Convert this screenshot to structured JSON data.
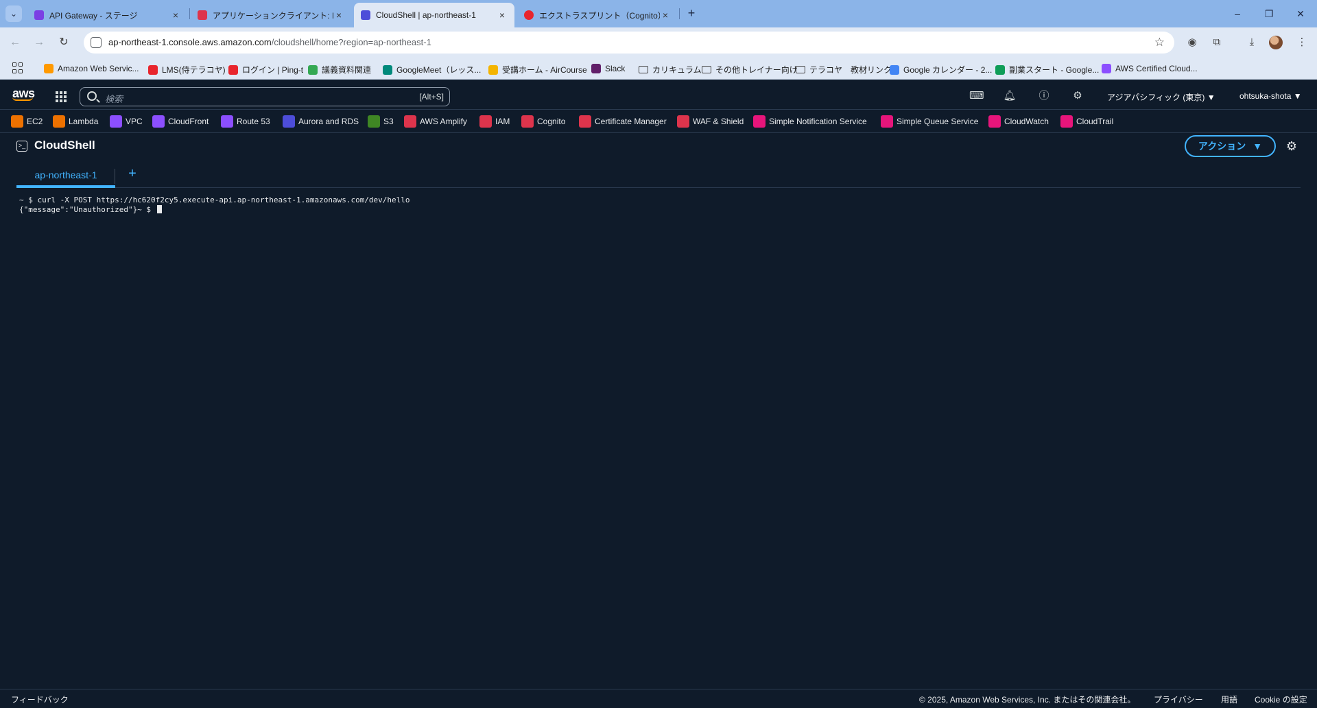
{
  "browser": {
    "tabs": [
      {
        "title": "API Gateway - ステージ",
        "color": "#7b3fe4"
      },
      {
        "title": "アプリケーションクライアント: My SPA",
        "color": "#dd344c"
      },
      {
        "title": "CloudShell | ap-northeast-1",
        "color": "#4d4dd9"
      },
      {
        "title": "エクストラスプリント（Cognito）| ファ",
        "color": "#e8252d"
      }
    ],
    "new_tab": "+",
    "close_glyph": "×",
    "url_host": "ap-northeast-1.console.aws.amazon.com",
    "url_path": "/cloudshell/home?region=ap-northeast-1",
    "bookmarks": [
      {
        "label": "Amazon Web Servic...",
        "color": "#ff9900"
      },
      {
        "label": "LMS(侍テラコヤ)",
        "color": "#e8252d"
      },
      {
        "label": "ログイン | Ping-t",
        "color": "#e8252d"
      },
      {
        "label": "議義資料関連",
        "color": "#34a853"
      },
      {
        "label": "GoogleMeet（レッス...",
        "color": "#00897b"
      },
      {
        "label": "受講ホーム - AirCourse",
        "color": "#f4b400"
      },
      {
        "label": "Slack",
        "color": "#611f69"
      },
      {
        "label": "カリキュラム",
        "folder": true
      },
      {
        "label": "その他トレイナー向け",
        "folder": true
      },
      {
        "label": "テラコヤ　教材リンク",
        "folder": true
      },
      {
        "label": "Google カレンダー - 2...",
        "color": "#4285f4"
      },
      {
        "label": "副業スタート - Google...",
        "color": "#0f9d58"
      },
      {
        "label": "AWS Certified Cloud...",
        "color": "#8c4fff"
      }
    ]
  },
  "aws_header": {
    "logo": "aws",
    "search_placeholder": "検索",
    "search_shortcut": "[Alt+S]",
    "region": "アジアパシフィック (東京) ▼",
    "user": "ohtsuka-shota ▼"
  },
  "favorites": [
    {
      "label": "EC2",
      "color": "#ed7100"
    },
    {
      "label": "Lambda",
      "color": "#ed7100"
    },
    {
      "label": "VPC",
      "color": "#8c4fff"
    },
    {
      "label": "CloudFront",
      "color": "#8c4fff"
    },
    {
      "label": "Route 53",
      "color": "#8c4fff"
    },
    {
      "label": "Aurora and RDS",
      "color": "#4d4dd9"
    },
    {
      "label": "S3",
      "color": "#3f8624"
    },
    {
      "label": "AWS Amplify",
      "color": "#dd344c"
    },
    {
      "label": "IAM",
      "color": "#dd344c"
    },
    {
      "label": "Cognito",
      "color": "#dd344c"
    },
    {
      "label": "Certificate Manager",
      "color": "#dd344c"
    },
    {
      "label": "WAF & Shield",
      "color": "#dd344c"
    },
    {
      "label": "Simple Notification Service",
      "color": "#e7157b"
    },
    {
      "label": "Simple Queue Service",
      "color": "#e7157b"
    },
    {
      "label": "CloudWatch",
      "color": "#e7157b"
    },
    {
      "label": "CloudTrail",
      "color": "#e7157b"
    }
  ],
  "cloudshell": {
    "title": "CloudShell",
    "action_label": "アクション",
    "tab_label": "ap-northeast-1",
    "add_tab": "+",
    "terminal_line1": "~ $ curl -X POST https://hc620f2cy5.execute-api.ap-northeast-1.amazonaws.com/dev/hello",
    "terminal_line2": "{\"message\":\"Unauthorized\"}~ $ "
  },
  "footer": {
    "feedback": "フィードバック",
    "copyright": "© 2025, Amazon Web Services, Inc. またはその関連会社。",
    "privacy": "プライバシー",
    "terms": "用語",
    "cookie": "Cookie の設定"
  }
}
